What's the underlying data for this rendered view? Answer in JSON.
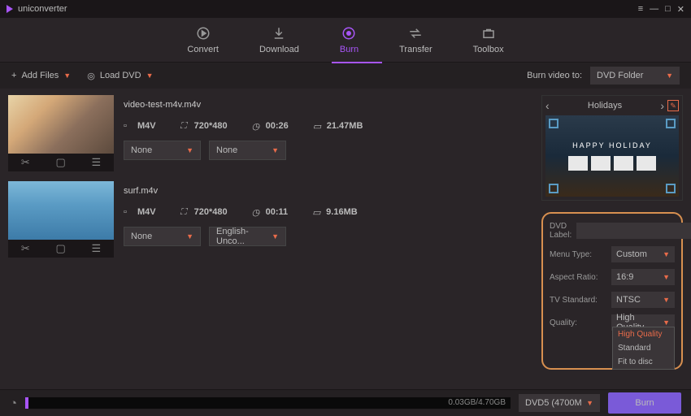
{
  "app": {
    "title": "uniconverter"
  },
  "tabs": {
    "convert": "Convert",
    "download": "Download",
    "burn": "Burn",
    "transfer": "Transfer",
    "toolbox": "Toolbox"
  },
  "toolbar": {
    "add_files": "Add Files",
    "load_dvd": "Load DVD",
    "burn_to_label": "Burn video to:",
    "burn_to_value": "DVD Folder"
  },
  "files": [
    {
      "name": "video-test-m4v.m4v",
      "fmt": "M4V",
      "res": "720*480",
      "dur": "00:26",
      "size": "21.47MB",
      "sel1": "None",
      "sel2": "None"
    },
    {
      "name": "surf.m4v",
      "fmt": "M4V",
      "res": "720*480",
      "dur": "00:11",
      "size": "9.16MB",
      "sel1": "None",
      "sel2": "English-Unco..."
    }
  ],
  "preview": {
    "title": "Holidays",
    "banner": "HAPPY HOLIDAY"
  },
  "settings": {
    "dvd_label_lbl": "DVD Label:",
    "dvd_label_val": "",
    "menu_type_lbl": "Menu Type:",
    "menu_type_val": "Custom",
    "aspect_lbl": "Aspect Ratio:",
    "aspect_val": "16:9",
    "tv_lbl": "TV Standard:",
    "tv_val": "NTSC",
    "quality_lbl": "Quality:",
    "quality_val": "High Quality",
    "quality_opts": [
      "High Quality",
      "Standard",
      "Fit to disc"
    ]
  },
  "bottom": {
    "progress": "0.03GB/4.70GB",
    "disc": "DVD5 (4700M",
    "burn": "Burn"
  }
}
